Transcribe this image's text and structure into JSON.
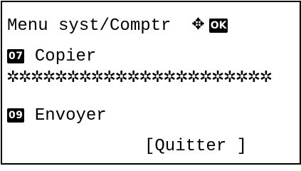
{
  "header": {
    "title": "Menu syst/Comptr",
    "nav_icon": "four-way-arrow-icon",
    "nav_glyph": "✥",
    "ok_label": "OK"
  },
  "menu": {
    "items": [
      {
        "number": "07",
        "label": "Copier"
      },
      {
        "number": "09",
        "label": "Envoyer"
      }
    ],
    "masked_line": "✲✲✲✲✲✲✲✲✲✲✲✲✲✲✲✲✲✲✲✲✲✲"
  },
  "softkeys": {
    "right_label": "[Quitter ]"
  }
}
